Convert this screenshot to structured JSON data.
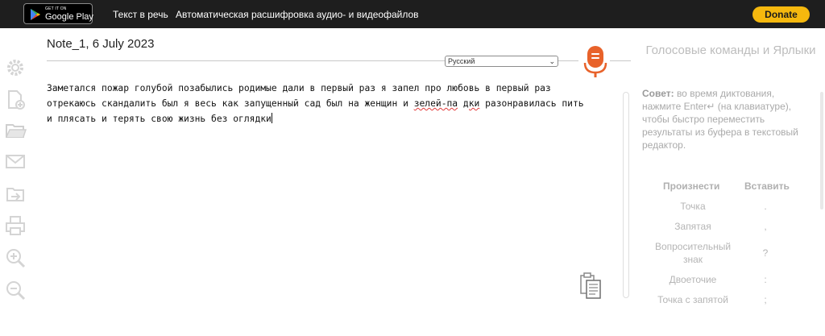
{
  "topbar": {
    "google_play": {
      "small": "GET IT ON",
      "big": "Google Play"
    },
    "links": [
      "Текст в речь",
      "Автоматическая расшифровка аудио- и видеофайлов"
    ],
    "donate_label": "Donate"
  },
  "toolbar": {
    "icons": [
      "gear-icon",
      "new-document-icon",
      "open-folder-icon",
      "email-icon",
      "export-icon",
      "print-icon",
      "zoom-in-icon",
      "zoom-out-icon"
    ]
  },
  "note": {
    "title": "Note_1, 6 July 2023",
    "language": "Русский",
    "lines": [
      "Заметался пожар голубой позабылись родимые дали в первый раз я запел про любовь в первый раз",
      "отрекаюсь скандалить был я весь как запущенный сад был на женщин и ",
      "и плясать и терять свою жизнь без оглядки"
    ],
    "misspelled_1": "зелей-па",
    "misspelled_2": "дки",
    "line2_tail": " разонравилась пить"
  },
  "panel": {
    "title": "Голосовые команды и Ярлыки",
    "tip_label": "Совет:",
    "tip_text": " во время диктования, нажмите Enter↵ (на клавиатуре), чтобы быстро переместить результаты из буфера в текстовый редактор.",
    "col_say": "Произнести",
    "col_insert": "Вставить",
    "commands": [
      {
        "say": "Точка",
        "insert": "."
      },
      {
        "say": "Запятая",
        "insert": ","
      },
      {
        "say": "Вопросительный знак",
        "insert": "?"
      },
      {
        "say": "Двоеточие",
        "insert": ":"
      },
      {
        "say": "Точка с запятой",
        "insert": ";"
      }
    ]
  },
  "colors": {
    "topbar": "#1e1e1e",
    "donate": "#f5b80e",
    "mic": "#e8622a"
  }
}
